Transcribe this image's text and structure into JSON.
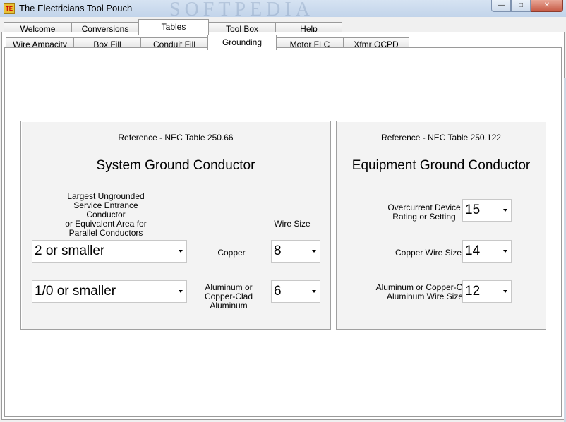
{
  "window": {
    "title": "The Electricians Tool Pouch",
    "icon_text": "TE",
    "watermark": "SOFTPEDIA"
  },
  "main_tabs": [
    {
      "label": "Welcome"
    },
    {
      "label": "Conversions"
    },
    {
      "label": "Tables"
    },
    {
      "label": "Tool Box"
    },
    {
      "label": "Help"
    }
  ],
  "sub_tabs": [
    {
      "label": "Wire Ampacity"
    },
    {
      "label": "Box Fill"
    },
    {
      "label": "Conduit Fill"
    },
    {
      "label": "Grounding"
    },
    {
      "label": "Motor FLC"
    },
    {
      "label": "Xfmr OCPD"
    }
  ],
  "system_ground": {
    "reference": "Reference - NEC Table 250.66",
    "title": "System Ground Conductor",
    "service_label_lines": [
      "Largest Ungrounded",
      "Service Entrance Conductor",
      "or Equivalent Area for",
      "Parallel Conductors"
    ],
    "wire_size_label": "Wire Size",
    "copper_label": "Copper",
    "aluminum_label_lines": [
      "Aluminum or",
      "Copper-Clad Aluminum"
    ],
    "copper_service_value": "2 or smaller",
    "aluminum_service_value": "1/0 or smaller",
    "copper_wire_value": "8",
    "aluminum_wire_value": "6"
  },
  "equipment_ground": {
    "reference": "Reference - NEC Table 250.122",
    "title": "Equipment Ground Conductor",
    "ocpd_label_lines": [
      "Overcurrent Device",
      "Rating or Setting"
    ],
    "copper_label": "Copper Wire Size",
    "aluminum_label_lines": [
      "Aluminum or Copper-Clad",
      "Aluminum Wire Size"
    ],
    "ocpd_value": "15",
    "copper_value": "14",
    "aluminum_value": "12"
  }
}
